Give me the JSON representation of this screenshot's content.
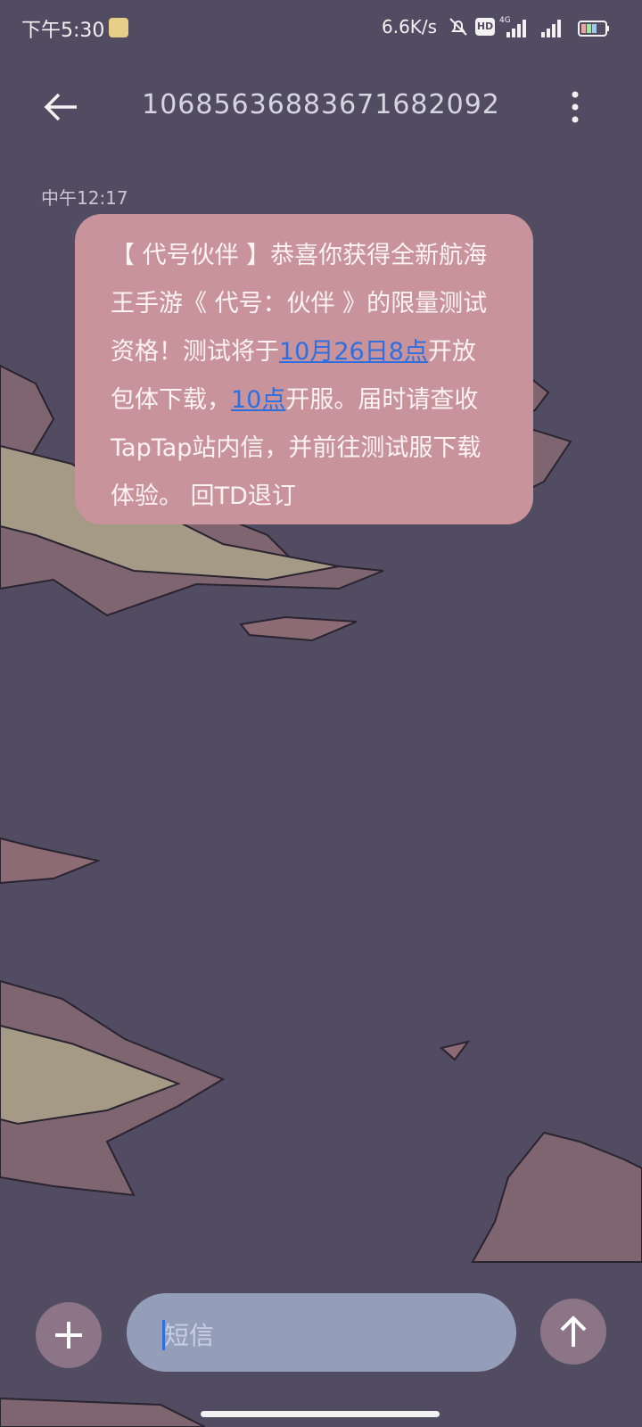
{
  "status_bar": {
    "time": "下午5:30",
    "net_speed": "6.6K/s",
    "hd_label": "HD",
    "network_type": "4G"
  },
  "header": {
    "title": "1068563688367168​2092"
  },
  "conversation": {
    "timestamp": "中午12:17",
    "message": {
      "seg1": "【 代号伙伴 】恭喜你获得全新航海王手游《 代号：伙伴 》的限量测试资格！测试将于",
      "link1": "10月26日8点",
      "seg2": "开放包体下载，",
      "link2": "10点",
      "seg3": "开服。届时请查收TapTap站内信，并前往测试服下载体验。 回TD退订"
    }
  },
  "input_bar": {
    "placeholder": "短信"
  },
  "colors": {
    "background": "#524c63",
    "bubble": "#c9939c",
    "link": "#2e6fe0",
    "input": "#959eb9",
    "round_button": "#8c7586"
  }
}
